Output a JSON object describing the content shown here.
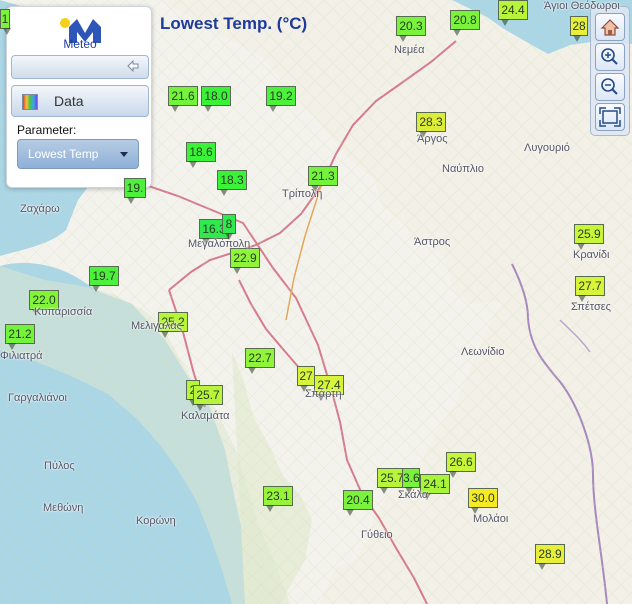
{
  "header": {
    "title": "Lowest Temp. (°C)"
  },
  "sidebar": {
    "logo_text": "Meteo",
    "data_label": "Data",
    "parameter_label": "Parameter:",
    "parameter_value": "Lowest Temp"
  },
  "toolbar": {
    "icons": [
      "home-icon",
      "zoom-in-icon",
      "zoom-out-icon",
      "fullscreen-icon"
    ]
  },
  "map": {
    "markers": [
      {
        "value": "20.3",
        "color": "#7bf33d"
      },
      {
        "value": "20.8",
        "color": "#7bf33d"
      },
      {
        "value": "24.4",
        "color": "#b7f43a"
      },
      {
        "value": "28",
        "color": "#e7ef3a"
      },
      {
        "value": "21.6",
        "color": "#74f23c"
      },
      {
        "value": "18.0",
        "color": "#3af238"
      },
      {
        "value": "19.2",
        "color": "#4df03c"
      },
      {
        "value": "28.3",
        "color": "#ddec39"
      },
      {
        "value": "18.6",
        "color": "#3af238"
      },
      {
        "value": "18.3",
        "color": "#3af238"
      },
      {
        "value": "21.3",
        "color": "#74f23c"
      },
      {
        "value": "16.3",
        "color": "#2fe94f"
      },
      {
        "value": "8",
        "color": "#2fe94f"
      },
      {
        "value": "22.9",
        "color": "#90f43b"
      },
      {
        "value": "25.9",
        "color": "#c8f43a"
      },
      {
        "value": "19.7",
        "color": "#4df03c"
      },
      {
        "value": "22.0",
        "color": "#82f33b"
      },
      {
        "value": "27.7",
        "color": "#d8f43a"
      },
      {
        "value": "21.2",
        "color": "#74f23c"
      },
      {
        "value": "25.2",
        "color": "#b7f43a"
      },
      {
        "value": "22.7",
        "color": "#90f43b"
      },
      {
        "value": "27",
        "color": "#d8f43a"
      },
      {
        "value": "27.4",
        "color": "#d8f43a"
      },
      {
        "value": "2",
        "color": "#b7f43a"
      },
      {
        "value": "25.7",
        "color": "#b7f43a"
      },
      {
        "value": "26.6",
        "color": "#c8f43a"
      },
      {
        "value": "25.7",
        "color": "#b7f43a"
      },
      {
        "value": "3.6",
        "color": "#7bf33d"
      },
      {
        "value": "24.1",
        "color": "#a8f43a"
      },
      {
        "value": "23.1",
        "color": "#98f43b"
      },
      {
        "value": "20.4",
        "color": "#7bf33d"
      },
      {
        "value": "30.0",
        "color": "#f5ea25"
      },
      {
        "value": "28.9",
        "color": "#e7ef3a"
      },
      {
        "value": "1",
        "color": "#7bf33d"
      },
      {
        "value": "19.",
        "color": "#4df03c"
      }
    ],
    "places": [
      "Νεμέα",
      "Άργος",
      "Λυγουριό",
      "Ναύπλιο",
      "Τρίπολη",
      "Ζαχάρω",
      "Μεγαλόπολη",
      "Άστρος",
      "Κρανίδι",
      "Κυπαρισσία",
      "Μελιγαλάς",
      "Σπέτσες",
      "Φιλιατρά",
      "Λεωνίδιο",
      "Γαργαλιάνοι",
      "Καλαμάτα",
      "Σπάρτη",
      "Πύλος",
      "Σκάλα",
      "Μεθώνη",
      "Μολάοι",
      "Κορώνη",
      "Γύθειο",
      "Άγιοι Θεόδωροι"
    ]
  }
}
